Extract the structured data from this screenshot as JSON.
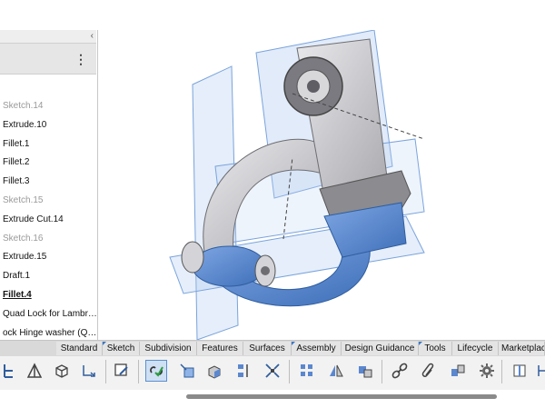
{
  "tree": {
    "collapse_glyph": "‹",
    "menu_glyph": "⋮",
    "items": [
      {
        "label": "Sketch.14",
        "state": "dim"
      },
      {
        "label": "Extrude.10",
        "state": "normal"
      },
      {
        "label": "Fillet.1",
        "state": "normal"
      },
      {
        "label": "Fillet.2",
        "state": "normal"
      },
      {
        "label": "Fillet.3",
        "state": "normal"
      },
      {
        "label": "Sketch.15",
        "state": "dim"
      },
      {
        "label": "Extrude Cut.14",
        "state": "normal"
      },
      {
        "label": "Sketch.16",
        "state": "dim"
      },
      {
        "label": "Extrude.15",
        "state": "normal"
      },
      {
        "label": "Draft.1",
        "state": "normal"
      },
      {
        "label": "Fillet.4",
        "state": "selected"
      },
      {
        "label": "Quad Lock for Lambr…",
        "state": "normal"
      },
      {
        "label": "ock Hinge washer (Q…",
        "state": "normal"
      }
    ]
  },
  "tabs": [
    {
      "label": "Standard",
      "active": false
    },
    {
      "label": "Sketch",
      "active": true
    },
    {
      "label": "Subdivision",
      "active": false
    },
    {
      "label": "Features",
      "active": false
    },
    {
      "label": "Surfaces",
      "active": false
    },
    {
      "label": "Assembly",
      "active": true
    },
    {
      "label": "Design Guidance",
      "active": false
    },
    {
      "label": "Tools",
      "active": true
    },
    {
      "label": "Lifecycle",
      "active": false
    },
    {
      "label": "Marketplace",
      "active": false
    }
  ],
  "toolbar": {
    "icons": [
      "line-icon",
      "triangle-icon",
      "cube-icon",
      "arrow-curve-icon",
      "sketch-edit-icon",
      "link-check-icon",
      "move-part-icon",
      "shaded-box-icon",
      "distribute-icon",
      "explode-icon",
      "pattern-grid-icon",
      "mirror-icon",
      "mate-icon",
      "chain-icon",
      "paperclip-icon",
      "assembly-icon",
      "gear-icon",
      "smart-fastener-icon",
      "dimension-icon"
    ]
  },
  "colors": {
    "accent": "#3b78c4",
    "part_blue": "#5b87cf",
    "part_gray": "#c9c9cc"
  }
}
